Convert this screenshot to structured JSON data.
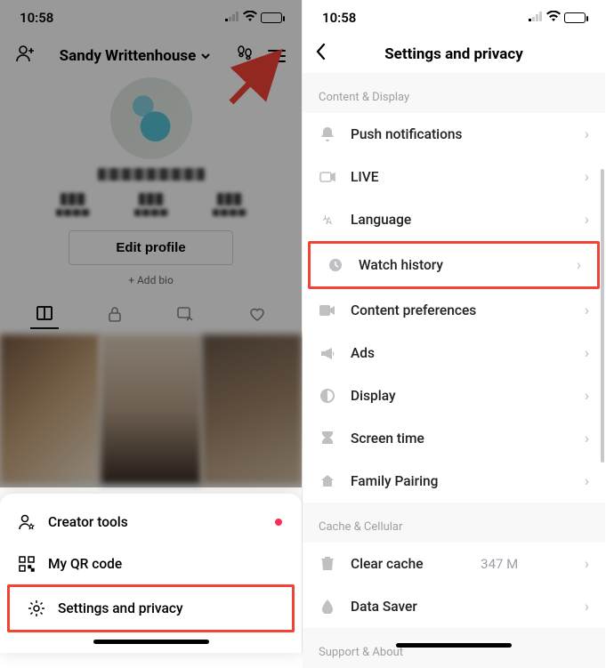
{
  "status": {
    "time": "10:58"
  },
  "left": {
    "username": "Sandy Writtenhouse",
    "edit_profile": "Edit profile",
    "add_bio": "+ Add bio",
    "sheet": {
      "creator_tools": "Creator tools",
      "my_qr": "My QR code",
      "settings_privacy": "Settings and privacy"
    }
  },
  "right": {
    "title": "Settings and privacy",
    "section_content_display": "Content & Display",
    "items": {
      "push": "Push notifications",
      "live": "LIVE",
      "language": "Language",
      "watch_history": "Watch history",
      "content_pref": "Content preferences",
      "ads": "Ads",
      "display": "Display",
      "screen_time": "Screen time",
      "family": "Family Pairing"
    },
    "section_cache": "Cache & Cellular",
    "clear_cache": "Clear cache",
    "clear_cache_val": "347 M",
    "data_saver": "Data Saver",
    "section_support": "Support & About"
  }
}
